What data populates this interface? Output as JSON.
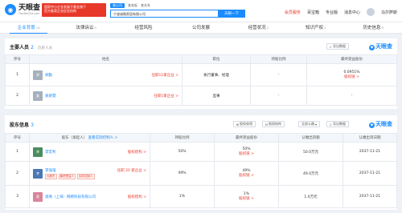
{
  "header": {
    "logo_name": "天眼查",
    "logo_url": "TianYanCha.com",
    "banner_line1": "国家中小企业发展子基金旗下",
    "banner_line2": "官方备案企业征信机构",
    "search_tabs": [
      "查公司",
      "查老板",
      "查关系"
    ],
    "search_value": "宁波诚微家居有限公司",
    "search_button": "天眼一下",
    "nav": {
      "vip": "会员服务",
      "pro": "百宝箱",
      "edition": "专业版",
      "messages": "消息中心",
      "user": "马尔萨斯"
    }
  },
  "tabs": [
    {
      "label": "企业背景",
      "count": "14"
    },
    {
      "label": "法律诉讼",
      "count": "0"
    },
    {
      "label": "经营风险",
      "count": ""
    },
    {
      "label": "公司发展",
      "count": ""
    },
    {
      "label": "经营状况",
      "count": "1"
    },
    {
      "label": "知识产权",
      "count": "2"
    },
    {
      "label": "历史信息",
      "count": "9"
    }
  ],
  "staff": {
    "title": "主要人员",
    "count": "2",
    "history": "历史人员",
    "export": "导出数据",
    "columns": [
      "序号",
      "姓名",
      "职位",
      "持股比例",
      "最终受益股份"
    ],
    "rows": [
      {
        "no": "1",
        "avatar": "郑",
        "name": "郑勤",
        "link": "任职11家企业 >",
        "position": "执行董事、经理",
        "ratio": "-",
        "benefit": "0.0951%",
        "benefit_link": "股权链 >"
      },
      {
        "no": "2",
        "avatar": "姜",
        "name": "姜艳慧",
        "link": "任职1家企业 >",
        "position": "监事",
        "ratio": "-",
        "benefit": "-",
        "benefit_link": ""
      }
    ]
  },
  "shareholders": {
    "title": "股东信息",
    "count": "3",
    "btn_tree": "股权穿透",
    "btn_tree2": "股权结构",
    "select": "全部认缴",
    "export": "导出数据",
    "columns": [
      "序号",
      "股东（发起人）",
      "持股比例",
      "最终受益股份",
      "认缴出资额",
      "认缴出资日期"
    ],
    "sub_link": "查看实际控制人 >",
    "rows": [
      {
        "no": "1",
        "avatar": "李",
        "name": "李宏利",
        "link": "股权结构 >",
        "tags": [],
        "ratio": "50%",
        "benefit": "50%",
        "benefit_link": "股权链 >",
        "amount": "50.0万元",
        "date": "2037-11-21"
      },
      {
        "no": "2",
        "avatar": "李",
        "name": "李强强",
        "link": "任职 20 家企业 >",
        "tags": [
          "大股东",
          "最终受益人",
          "实际控制人"
        ],
        "ratio": "49%",
        "benefit": "49%",
        "benefit_link": "股权链 >",
        "amount": "49.0万元",
        "date": "2037-11-21"
      },
      {
        "no": "3",
        "avatar": "奥",
        "name": "奥啊（上海）网络科技有限公司",
        "link": "股权结构 >",
        "tags": [],
        "ratio": "1%",
        "benefit": "1%",
        "benefit_link": "股权链 >",
        "amount": "1.0万元",
        "date": "2037-11-21"
      }
    ]
  },
  "watermark": "天眼查"
}
